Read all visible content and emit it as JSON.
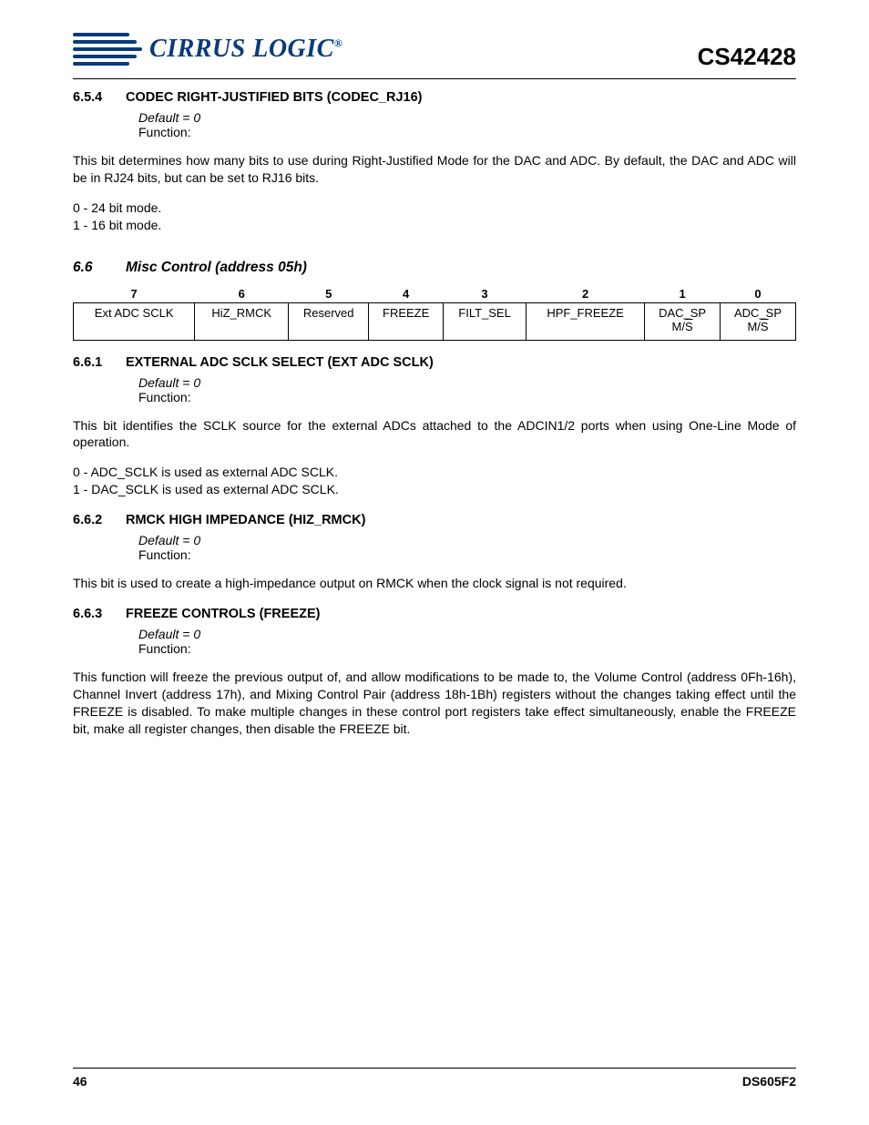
{
  "header": {
    "brand": "CIRRUS LOGIC",
    "reg_mark": "®",
    "part_number": "CS42428"
  },
  "sections": {
    "s654": {
      "num": "6.5.4",
      "title": "CODEC RIGHT-JUSTIFIED BITS (CODEC_RJ16)",
      "default": "Default = 0",
      "func_label": "Function:",
      "para1": "This bit determines how many bits to use during Right-Justified Mode for the DAC and ADC. By default, the DAC and ADC will be in RJ24 bits, but can be set to RJ16 bits.",
      "line0": "0 - 24 bit mode.",
      "line1": "1 - 16 bit mode."
    },
    "s66": {
      "num": "6.6",
      "title": "Misc Control (address 05h)",
      "bits": {
        "headers": [
          "7",
          "6",
          "5",
          "4",
          "3",
          "2",
          "1",
          "0"
        ],
        "b7": "Ext ADC SCLK",
        "b6": "HiZ_RMCK",
        "b5": "Reserved",
        "b4": "FREEZE",
        "b3": "FILT_SEL",
        "b2": "HPF_FREEZE",
        "b1a": "DAC_SP",
        "b1b": "M/S",
        "b0a": "ADC_SP",
        "b0b": "M/S"
      }
    },
    "s661": {
      "num": "6.6.1",
      "title": "EXTERNAL ADC SCLK SELECT (EXT ADC SCLK)",
      "default": "Default = 0",
      "func_label": "Function:",
      "para1": "This bit identifies the SCLK source for the external ADCs attached to the ADCIN1/2 ports when using One-Line Mode of operation.",
      "line0": "0 - ADC_SCLK is used as external ADC SCLK.",
      "line1": "1 - DAC_SCLK is used as external ADC SCLK."
    },
    "s662": {
      "num": "6.6.2",
      "title": "RMCK HIGH IMPEDANCE (HIZ_RMCK)",
      "default": "Default = 0",
      "func_label": "Function:",
      "para1": "This bit is used to create a high-impedance output on RMCK when the clock signal is not required."
    },
    "s663": {
      "num": "6.6.3",
      "title": "FREEZE CONTROLS (FREEZE)",
      "default": "Default = 0",
      "func_label": "Function:",
      "para1": "This function will freeze the previous output of, and allow modifications to be made to, the Volume Control (address 0Fh-16h), Channel Invert (address 17h), and Mixing Control Pair (address 18h-1Bh) registers without the changes taking effect until the FREEZE is disabled. To make multiple changes in these control port registers take effect simultaneously, enable the FREEZE bit, make all register changes, then disable the FREEZE bit."
    }
  },
  "footer": {
    "page": "46",
    "doc": "DS605F2"
  }
}
